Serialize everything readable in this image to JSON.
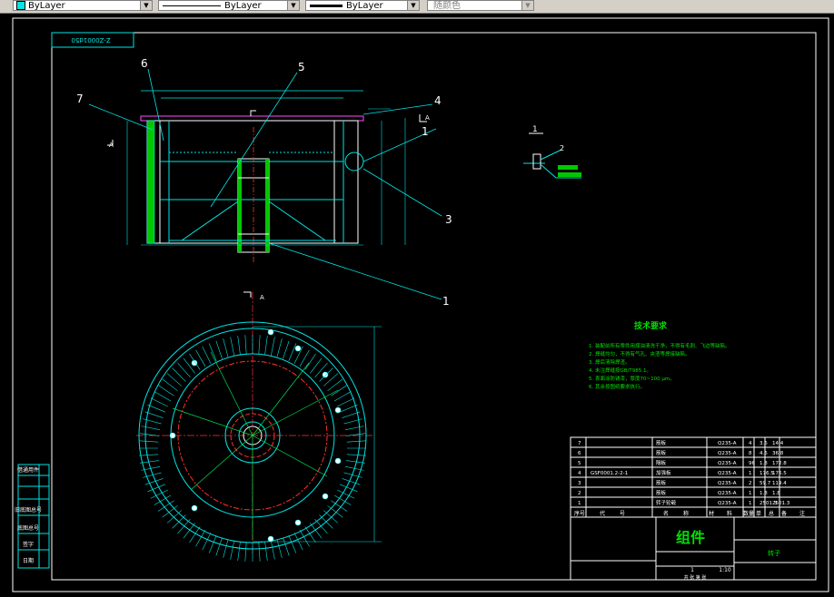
{
  "toolbar": {
    "color_value": "ByLayer",
    "linetype_value": "ByLayer",
    "lineweight_value": "ByLayer",
    "plotstyle_value": "随颜色"
  },
  "drawing": {
    "doc_code_rotated": "Z-Z0001d50",
    "callouts": [
      "7",
      "6",
      "5",
      "4",
      "3",
      "2",
      "1",
      "1"
    ],
    "detail_label": "1",
    "detail_callout": "2",
    "section_label_top": "A",
    "section_label_left": "A",
    "section_label_right": "A",
    "tech_title": "技术要求",
    "tech_items": [
      "1. 装配前所有零件用煤油清洗干净，不得有毛刺、飞边等缺陷。",
      "2. 焊缝均匀，不得有气孔、夹渣等焊接缺陷。",
      "3. 焊后清除焊渣。",
      "4. 未注焊缝按GB/T985.1。",
      "5. 表面涂防锈漆，厚度70~100 μm。",
      "6. 其余按图纸要求执行。"
    ]
  },
  "bom": {
    "rows": [
      {
        "no": "7",
        "code": "",
        "name": "筋板",
        "material": "Q235-A",
        "qty": "4",
        "w1": "3.6",
        "w2": "14.4"
      },
      {
        "no": "6",
        "code": "",
        "name": "筋板",
        "material": "Q235-A",
        "qty": "8",
        "w1": "4.6",
        "w2": "36.8"
      },
      {
        "no": "5",
        "code": "",
        "name": "隔板",
        "material": "Q235-A",
        "qty": "96",
        "w1": "1.8",
        "w2": "172.8"
      },
      {
        "no": "4",
        "code": "GSF0001.2-2-1",
        "name": "加强板",
        "material": "Q235-A",
        "qty": "1",
        "w1": "176.5",
        "w2": "176.5"
      },
      {
        "no": "3",
        "code": "",
        "name": "筋板",
        "material": "Q235-A",
        "qty": "2",
        "w1": "59.7",
        "w2": "119.4"
      },
      {
        "no": "2",
        "code": "",
        "name": "筋板",
        "material": "Q235-A",
        "qty": "1",
        "w1": "1.8",
        "w2": "1.8"
      },
      {
        "no": "1",
        "code": "",
        "name": "转子轮毂",
        "material": "Q235-A",
        "qty": "1",
        "w1": "2501.3",
        "w2": "2501.3"
      }
    ],
    "header": [
      "序号",
      "代",
      "号",
      "名",
      "称",
      "材",
      "料",
      "数量",
      "单",
      "总",
      "备",
      "注"
    ],
    "title": "组件",
    "part_name": "转子",
    "scale": "1:10",
    "qty": "1",
    "sheet": "共 张 第 张"
  },
  "left_table": [
    "借通用件",
    "",
    "",
    "",
    "旧底图总号",
    "",
    "底图总号",
    "",
    "签字",
    "日期"
  ]
}
